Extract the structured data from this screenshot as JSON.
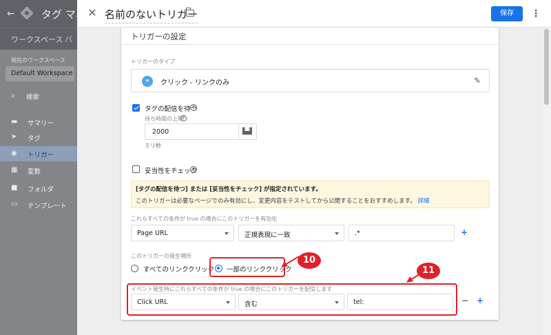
{
  "background": {
    "app_title": "タグ マネ",
    "tabs": [
      "ワークスペース",
      "バ"
    ],
    "workspace_label": "現在のワークスペース",
    "workspace_name": "Default Workspace",
    "search_label": "検索",
    "nav": [
      {
        "label": "サマリー",
        "icon": "summary-icon"
      },
      {
        "label": "タグ",
        "icon": "tag-icon"
      },
      {
        "label": "トリガー",
        "icon": "trigger-icon",
        "active": true
      },
      {
        "label": "変数",
        "icon": "variable-icon"
      },
      {
        "label": "フォルダ",
        "icon": "folder-icon"
      },
      {
        "label": "テンプレート",
        "icon": "template-icon"
      }
    ]
  },
  "header": {
    "trigger_name": "名前のないトリガー",
    "save_label": "保存"
  },
  "card": {
    "title": "トリガーの設定",
    "type_section_label": "トリガーのタイプ",
    "type_value": "クリック - リンクのみ",
    "wait_for_tags_label": "タグの配信を待つ",
    "wait_for_tags_checked": true,
    "max_wait_label": "待ち時間の上限",
    "max_wait_value": "2000",
    "unit_label": "ミリ秒",
    "check_validation_label": "妥当性をチェック",
    "check_validation_checked": false,
    "notice_title": "[タグの配信を待つ] または [妥当性をチェック] が指定されています。",
    "notice_body": "このトリガーは必要なページでのみ有効にし、変更内容をテストしてから公開することをおすすめします。",
    "notice_link": "詳細",
    "enable_conditions_label": "これらすべての条件が true の場合にこのトリガーを有効化",
    "enable_condition": {
      "variable": "Page URL",
      "operator": "正規表現に一致",
      "value": ".*"
    },
    "fire_on_label": "このトリガーの発生場所",
    "fire_on_options": [
      "すべてのリンククリック",
      "一部のリンククリック"
    ],
    "fire_on_selected": 1,
    "fire_conditions_label": "イベント発生時にこれらすべての条件が true の場合にこのトリガーを配信します",
    "fire_condition": {
      "variable": "Click URL",
      "operator": "含む",
      "value": "tel:"
    }
  },
  "annotations": {
    "badge_10": "10",
    "badge_11": "11",
    "color": "#e0202a"
  }
}
